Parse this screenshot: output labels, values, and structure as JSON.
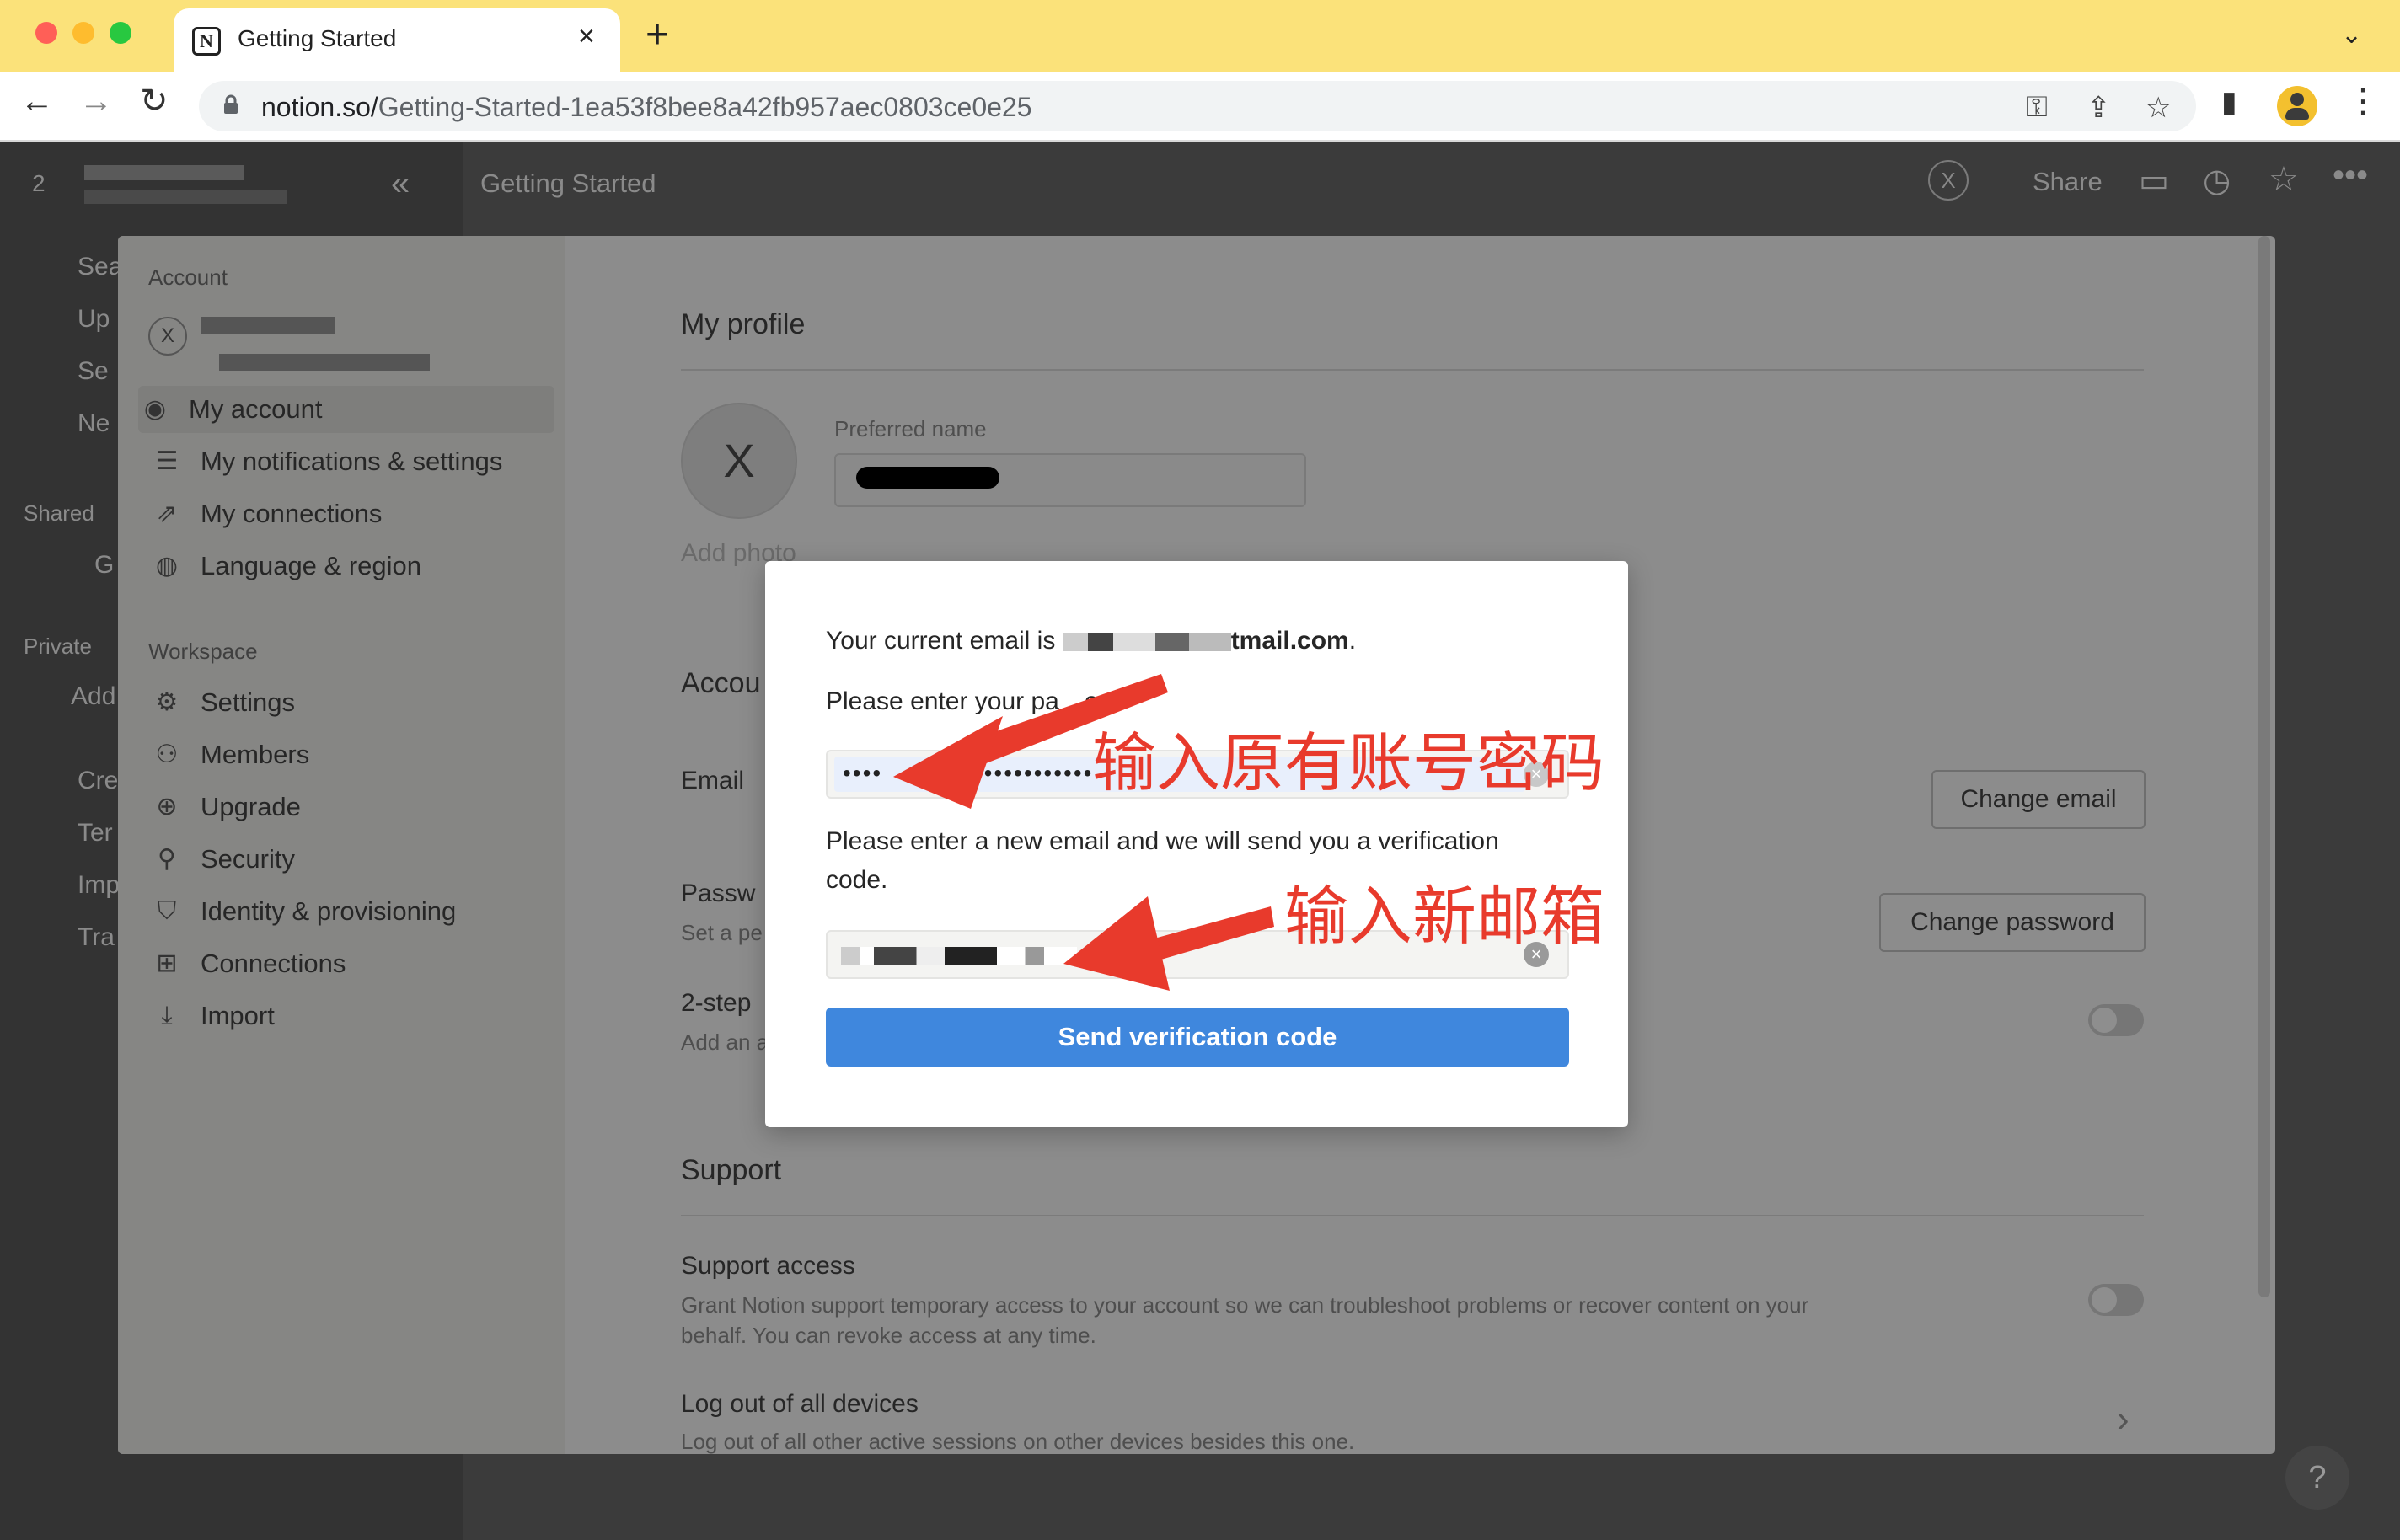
{
  "browser": {
    "tab_title": "Getting Started",
    "tab_close": "×",
    "new_tab": "+",
    "tab_menu": "⌄",
    "url_host": "notion.so/",
    "url_path": "Getting-Started-1ea53f8bee8a42fb957aec0803ce0e25",
    "nav": {
      "back": "←",
      "forward": "→",
      "reload": "↻",
      "key": "⚿",
      "share": "⇪",
      "star": "☆",
      "sidebar": "▮",
      "menu": "⋮"
    }
  },
  "notion": {
    "workspace_initial": "2",
    "collapse": "«",
    "page_title": "Getting Started",
    "avatar_letter": "X",
    "share": "Share",
    "sidebar_fragments": [
      "Sea",
      "Up",
      "Se",
      "Ne",
      "Shared",
      "G",
      "Private",
      "Add",
      "Cre",
      "Ter",
      "Imp",
      "Tra"
    ],
    "help": "?"
  },
  "settings": {
    "account_section": "Account",
    "user_initial": "X",
    "items": [
      {
        "icon": "◉",
        "label": "My account"
      },
      {
        "icon": "☰",
        "label": "My notifications & settings"
      },
      {
        "icon": "⇗",
        "label": "My connections"
      },
      {
        "icon": "◍",
        "label": "Language & region"
      }
    ],
    "workspace_section": "Workspace",
    "workspace_items": [
      {
        "icon": "⚙",
        "label": "Settings"
      },
      {
        "icon": "⚇",
        "label": "Members"
      },
      {
        "icon": "⊕",
        "label": "Upgrade"
      },
      {
        "icon": "⚲",
        "label": "Security"
      },
      {
        "icon": "⛉",
        "label": "Identity & provisioning"
      },
      {
        "icon": "⊞",
        "label": "Connections"
      },
      {
        "icon": "⤓",
        "label": "Import"
      }
    ],
    "my_profile": "My profile",
    "avatar_letter": "X",
    "add_photo": "Add photo",
    "preferred_name_label": "Preferred name",
    "account_security_fragment": "Accou",
    "email_label": "Email",
    "change_email": "Change email",
    "password_label": "Passw",
    "password_sub": "Set a pe",
    "change_password": "Change password",
    "twostep_label": "2-step",
    "twostep_sub": "Add an a",
    "support": "Support",
    "support_access": "Support access",
    "support_desc_1": "Grant Notion support temporary access to your account so we can troubleshoot problems or recover content on your",
    "support_desc_2": "behalf. You can revoke access at any time.",
    "logout_all": "Log out of all devices",
    "logout_desc": "Log out of all other active sessions on other devices besides this one.",
    "chevron": "›"
  },
  "dialog": {
    "current_email_prefix": "Your current email is",
    "current_email_suffix": "tmail.com",
    "period": ".",
    "enter_password_1": "Please enter your pa",
    "enter_password_2": "ord.",
    "password_dots_1": "••••",
    "password_dots_2": "•••••••••••••",
    "new_email_text_1": "Please enter a new email and we will send you a verification",
    "new_email_text_2": "code.",
    "clear": "×",
    "send_button": "Send verification code"
  },
  "annotations": {
    "password_note": "输入原有账号密码",
    "email_note": "输入新邮箱"
  },
  "colors": {
    "chrome_tabbar": "#fbe27a",
    "primary_button": "#3f87dd",
    "annotation_red": "#e83a2c"
  }
}
